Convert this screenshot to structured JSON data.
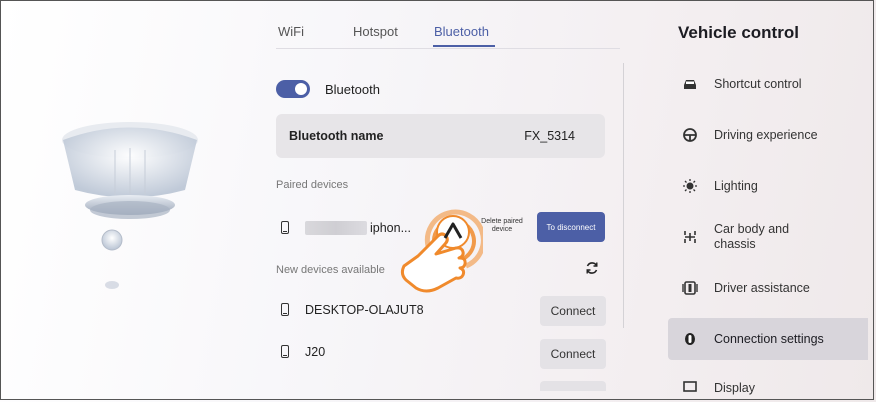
{
  "tabs": [
    "WiFi",
    "Hotspot",
    "Bluetooth"
  ],
  "active_tab": "Bluetooth",
  "bluetooth": {
    "toggle_label": "Bluetooth",
    "enabled": true,
    "name_label": "Bluetooth name",
    "name_value": "FX_5314"
  },
  "paired": {
    "header": "Paired devices",
    "device_name": "iphon...",
    "delete_label": "Delete paired device",
    "disconnect_label": "To disconnect"
  },
  "available": {
    "header": "New devices available",
    "devices": [
      {
        "name": "DESKTOP-OLAJUT8",
        "action": "Connect"
      },
      {
        "name": "J20",
        "action": "Connect"
      }
    ]
  },
  "vehicle_control": {
    "title": "Vehicle control",
    "items": [
      {
        "label": "Shortcut control",
        "icon": "car-icon"
      },
      {
        "label": "Driving experience",
        "icon": "steering-wheel-icon"
      },
      {
        "label": "Lighting",
        "icon": "light-icon"
      },
      {
        "label": "Car body and chassis",
        "icon": "chassis-icon"
      },
      {
        "label": "Driver assistance",
        "icon": "driver-assist-icon"
      },
      {
        "label": "Connection settings",
        "icon": "connection-icon"
      },
      {
        "label": "Display",
        "icon": "display-icon"
      }
    ],
    "active_index": 5
  },
  "colors": {
    "accent": "#4c5fa6",
    "hand": "#f08a2c"
  }
}
